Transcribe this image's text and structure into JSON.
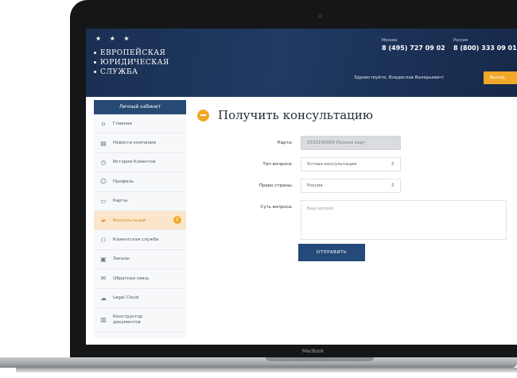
{
  "header": {
    "logo_lines": [
      "ЕВРОПЕЙСКАЯ",
      "ЮРИДИЧЕСКАЯ",
      "СЛУЖБА"
    ],
    "logo_stars": "★ ★ ★",
    "phone_moscow_city": "Москва",
    "phone_moscow": "8 (495) 727 09 02",
    "phone_russia_city": "Россия",
    "phone_russia": "8 (800) 333 09 01",
    "greeting": "Здравствуйте, Владислав Валерьевич!",
    "login_label": "Выход"
  },
  "sidebar": {
    "title": "Личный кабинет",
    "items": [
      {
        "label": "Главная",
        "icon": "home-icon"
      },
      {
        "label": "Новости компании",
        "icon": "news-icon"
      },
      {
        "label": "История Клиентов",
        "icon": "history-icon"
      },
      {
        "label": "Профиль",
        "icon": "user-icon"
      },
      {
        "label": "Карты",
        "icon": "cards-icon"
      },
      {
        "label": "Консультации",
        "icon": "folder-icon",
        "badge": "2"
      },
      {
        "label": "Клиентская служба",
        "icon": "support-icon"
      },
      {
        "label": "Заказы",
        "icon": "orders-icon"
      },
      {
        "label": "Обратная связь",
        "icon": "chat-icon"
      },
      {
        "label": "Legal Cloud",
        "icon": "cloud-icon"
      },
      {
        "label": "Конструктор документов",
        "icon": "constructor-icon"
      }
    ]
  },
  "main": {
    "title": "Получить консультацию",
    "form": {
      "card_label": "Карта:",
      "card_value": "3333100000 Полная карт",
      "topic_label": "Тип вопроса:",
      "topic_value": "Устная консультация",
      "law_label": "Право страны:",
      "law_value": "Россия",
      "question_label": "Суть вопроса:",
      "question_placeholder": "Ваш вопрос",
      "submit_label": "ОТПРАВИТЬ"
    }
  },
  "device": {
    "brand": "MacBook"
  },
  "colors": {
    "header": "#1f375d",
    "accent": "#f0a826",
    "sidebar_head": "#264a73",
    "button": "#234a78"
  }
}
